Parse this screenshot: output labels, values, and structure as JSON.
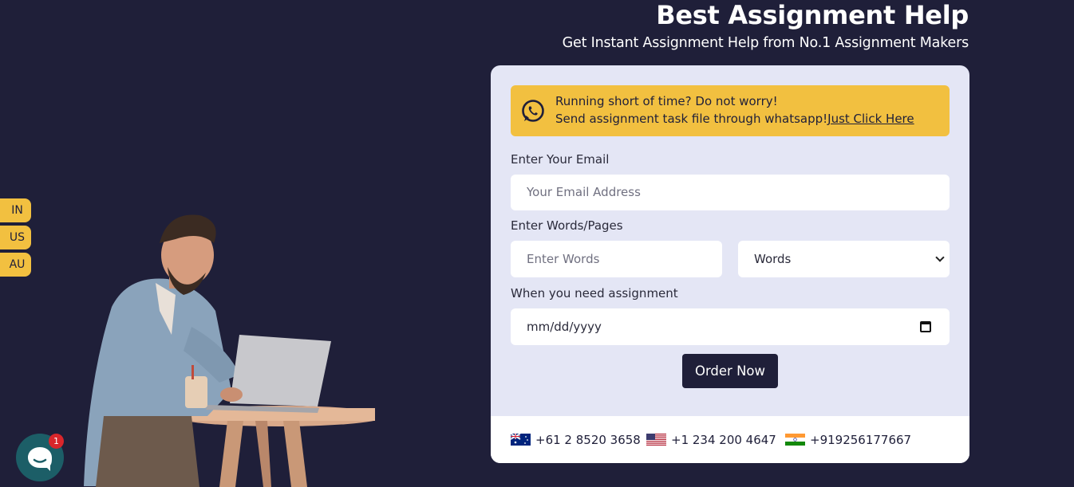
{
  "hero": {
    "title": "Best Assignment Help",
    "subtitle": "Get Instant Assignment Help from No.1 Assignment Makers"
  },
  "whatsapp_banner": {
    "icon": "whatsapp-icon",
    "line1": "Running short of time? Do not worry!",
    "line2": "Send assignment task file through whatsapp!",
    "link": "Just Click Here"
  },
  "form": {
    "email_label": "Enter Your Email",
    "email_placeholder": "Your Email Address",
    "words_label": "Enter Words/Pages",
    "words_placeholder": "Enter Words",
    "unit_selected": "Words",
    "date_label": "When you need assignment",
    "date_placeholder": "mm/dd/yyyy",
    "submit_label": "Order Now"
  },
  "phones": [
    {
      "country": "AU",
      "number": "+61 2 8520 3658"
    },
    {
      "country": "US",
      "number": "+1 234 200 4647"
    },
    {
      "country": "IN",
      "number": "+919256177667"
    }
  ],
  "side_tabs": [
    "IN",
    "US",
    "AU"
  ],
  "chat": {
    "badge_count": "1",
    "icon": "chat-bubble-icon"
  },
  "colors": {
    "background": "#1f1f39",
    "accent": "#f2c040",
    "card": "#e4e6f5"
  }
}
